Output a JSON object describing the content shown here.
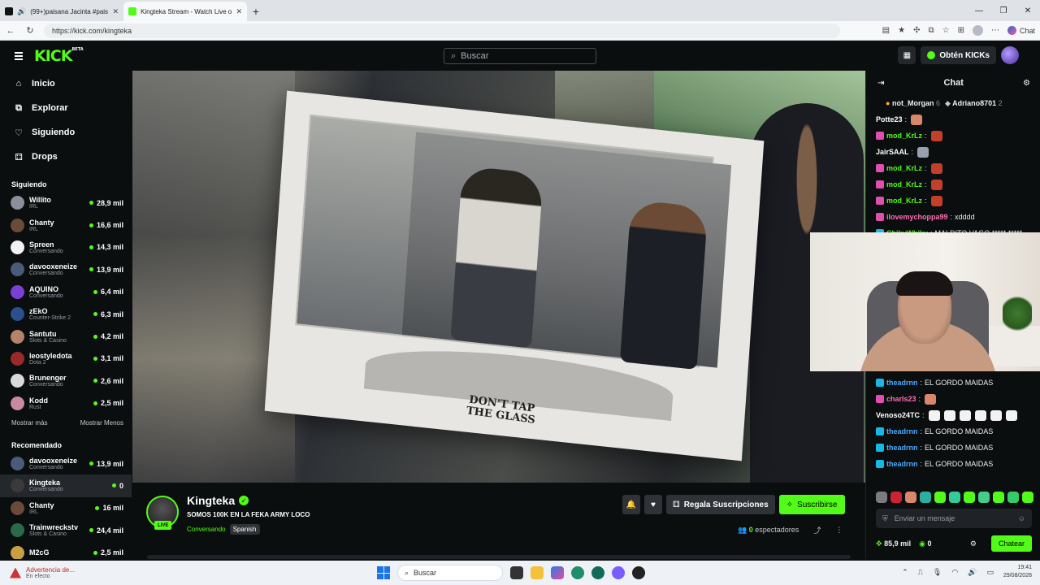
{
  "browser": {
    "tabs": [
      {
        "title": "(99+)paisana Jacinta #paisanaJ",
        "favicon_color": "#111111",
        "active": false
      },
      {
        "title": "Kingteka Stream - Watch Live on K",
        "favicon_color": "#53fc18",
        "active": true
      }
    ],
    "url": "https://kick.com/kingteka",
    "copilot_label": "Chat"
  },
  "header": {
    "logo": "KICK",
    "logo_sup": "BETA",
    "search_placeholder": "Buscar",
    "kicks_label": "Obtén KICKs"
  },
  "sidebar": {
    "nav": [
      {
        "label": "Inicio",
        "icon": "home-icon",
        "glyph": "⌂"
      },
      {
        "label": "Explorar",
        "icon": "compass-icon",
        "glyph": "⧉"
      },
      {
        "label": "Siguiendo",
        "icon": "heart-icon",
        "glyph": "♡"
      },
      {
        "label": "Drops",
        "icon": "gift-icon",
        "glyph": "⚃"
      }
    ],
    "following_title": "Siguiendo",
    "following": [
      {
        "name": "Willito",
        "category": "IRL",
        "viewers": "28,9 mil",
        "color": "#8a8f99"
      },
      {
        "name": "Chanty",
        "category": "IRL",
        "viewers": "16,6 mil",
        "color": "#6b4a3a"
      },
      {
        "name": "Spreen",
        "category": "Conversando",
        "viewers": "14,3 mil",
        "color": "#f2f2f2"
      },
      {
        "name": "davooxeneize",
        "category": "Conversando",
        "viewers": "13,9 mil",
        "color": "#4a5a7a"
      },
      {
        "name": "AQUINO",
        "category": "Conversando",
        "viewers": "6,4 mil",
        "color": "#7b3fd6"
      },
      {
        "name": "zEkO",
        "category": "Counter-Strike 2",
        "viewers": "6,3 mil",
        "color": "#2a4f8a"
      },
      {
        "name": "Santutu",
        "category": "Slots & Casino",
        "viewers": "4,2 mil",
        "color": "#b5826a"
      },
      {
        "name": "leostyledota",
        "category": "Dota 2",
        "viewers": "3,1 mil",
        "color": "#9a2a2a"
      },
      {
        "name": "Brunenger",
        "category": "Conversando",
        "viewers": "2,6 mil",
        "color": "#d9d9d9"
      },
      {
        "name": "Kodd",
        "category": "Rust",
        "viewers": "2,5 mil",
        "color": "#c98aa0"
      }
    ],
    "show_more": "Mostrar más",
    "show_less": "Mostrar Menos",
    "recommended_title": "Recomendado",
    "recommended": [
      {
        "name": "davooxeneize",
        "category": "Conversando",
        "viewers": "13,9 mil",
        "color": "#4a5a7a"
      },
      {
        "name": "Kingteka",
        "category": "Conversando",
        "viewers": "0",
        "color": "#3a3a3a",
        "selected": true
      },
      {
        "name": "Chanty",
        "category": "IRL",
        "viewers": "16 mil",
        "color": "#6b4a3a"
      },
      {
        "name": "Trainwreckstv",
        "category": "Slots & Casino",
        "viewers": "24,4 mil",
        "color": "#2a6a4a"
      },
      {
        "name": "M2cG",
        "category": "",
        "viewers": "2,5 mil",
        "color": "#c9a040"
      }
    ]
  },
  "video": {
    "sign_text_line1": "DON'T TAP",
    "sign_text_line2": "THE GLASS"
  },
  "stream": {
    "live_badge": "LIVE",
    "streamer": "Kingteka",
    "title": "SOMOS 100K EN LA FEKA ARMY LOCO",
    "category": "Conversando",
    "tag": "Spanish",
    "gift_label": "Regala Suscripciones",
    "subscribe_label": "Suscribirse",
    "viewer_count": "0",
    "viewer_label": "espectadores"
  },
  "chat": {
    "title": "Chat",
    "pinned": [
      {
        "name": "not_Morgan",
        "count": "6",
        "color": "#f3b53a"
      },
      {
        "name": "Adriano8701",
        "count": "2",
        "color": "#c8c8d0"
      }
    ],
    "messages_top": [
      {
        "user": "Potte23",
        "text": "",
        "user_color": "#ffffff",
        "badge": "",
        "emote": "#d9876a"
      },
      {
        "user": "mod_KrLz",
        "text": "",
        "user_color": "#53fc18",
        "badge": "#e04fb0",
        "emote": "#c2402a"
      },
      {
        "user": "JairSAAL",
        "text": "",
        "user_color": "#ffffff",
        "badge": "",
        "emote": "#9aa0b0"
      },
      {
        "user": "mod_KrLz",
        "text": "",
        "user_color": "#53fc18",
        "badge": "#e04fb0",
        "emote": "#c2402a"
      },
      {
        "user": "mod_KrLz",
        "text": "",
        "user_color": "#53fc18",
        "badge": "#e04fb0",
        "emote": "#c2402a"
      },
      {
        "user": "mod_KrLz",
        "text": "",
        "user_color": "#53fc18",
        "badge": "#e04fb0",
        "emote": "#c2402a"
      },
      {
        "user": "ilovemychoppa99",
        "text": "xdddd",
        "user_color": "#ff6eb4",
        "badge": "#e04fb0",
        "emote": ""
      },
      {
        "user": "ChikyWhiky",
        "text": "MALDITO VAGO ***** *****",
        "user_color": "#53fc18",
        "badge": "#19b7e6",
        "emote": ""
      }
    ],
    "messages_bottom": [
      {
        "user": "theadrnn",
        "text": "EL GORDO MAIDAS",
        "user_color": "#4aa8ff",
        "badge": "#19b7e6",
        "emote": ""
      },
      {
        "user": "charls23",
        "text": "",
        "user_color": "#ff6eb4",
        "badge": "#e04fb0",
        "emote": "#d9876a"
      },
      {
        "user": "Venoso24TC",
        "text": "",
        "user_color": "#ffffff",
        "badge": "",
        "emote": "#f2f2f2"
      },
      {
        "user": "theadrnn",
        "text": "EL GORDO MAIDAS",
        "user_color": "#4aa8ff",
        "badge": "#19b7e6",
        "emote": ""
      },
      {
        "user": "theadrnn",
        "text": "EL GORDO MAIDAS",
        "user_color": "#4aa8ff",
        "badge": "#19b7e6",
        "emote": ""
      },
      {
        "user": "theadrnn",
        "text": "EL GORDO MAIDAS",
        "user_color": "#4aa8ff",
        "badge": "#19b7e6",
        "emote": ""
      }
    ],
    "input_placeholder": "Enviar un mensaje",
    "kicks_balance": "85,9 mil",
    "points": "0",
    "send_label": "Chatear"
  },
  "taskbar": {
    "notification_title": "Advertencia de...",
    "notification_sub": "En efecto",
    "search_label": "Buscar",
    "time": "19:41",
    "date": "29/08/2026"
  },
  "colors": {
    "accent": "#53fc18",
    "bg": "#0b0e0f",
    "panel": "#24272c"
  }
}
